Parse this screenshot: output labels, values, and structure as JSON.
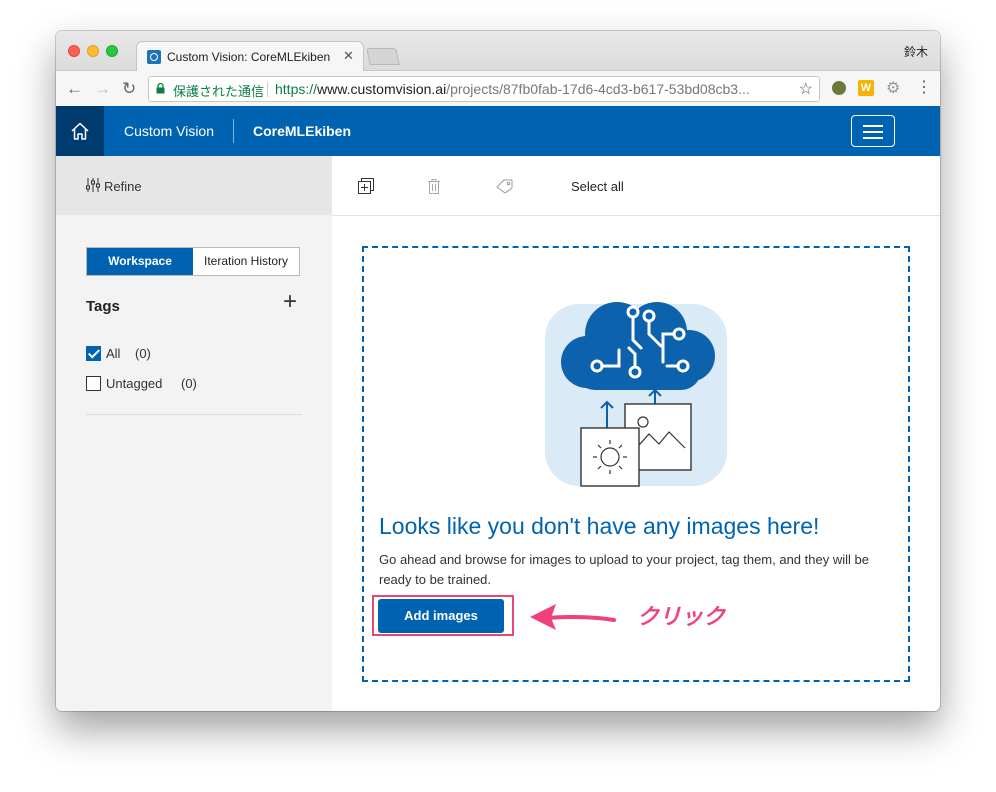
{
  "browser": {
    "tab_title": "Custom Vision: CoreMLEkiben",
    "tab_close": "✕",
    "profile": "鈴木",
    "security_label": "保護された通信",
    "url_scheme": "https://",
    "url_host": "www.customvision.ai",
    "url_path": "/projects/87fb0fab-17d6-4cd3-b617-53bd08cb3...",
    "ext_letter": "W"
  },
  "header": {
    "brand": "Custom Vision",
    "project": "CoreMLEkiben"
  },
  "sidebar": {
    "refine_label": "Refine",
    "segment": {
      "workspace": "Workspace",
      "iteration_history": "Iteration History",
      "selected": "Workspace"
    },
    "tags_title": "Tags",
    "add_tag_symbol": "+",
    "tags": [
      {
        "name": "All",
        "count": "(0)",
        "checked": true
      },
      {
        "name": "Untagged",
        "count": "(0)",
        "checked": false
      }
    ]
  },
  "toolbar": {
    "select_all": "Select all"
  },
  "empty_state": {
    "title": "Looks like you don't have any images here!",
    "description": "Go ahead and browse for images to upload to your project, tag them, and they will be ready to be trained.",
    "add_button": "Add images"
  },
  "annotation": {
    "click_label": "クリック",
    "color": "#f0417e"
  },
  "colors": {
    "accent": "#0063b1",
    "accent_dark": "#003b6f"
  }
}
